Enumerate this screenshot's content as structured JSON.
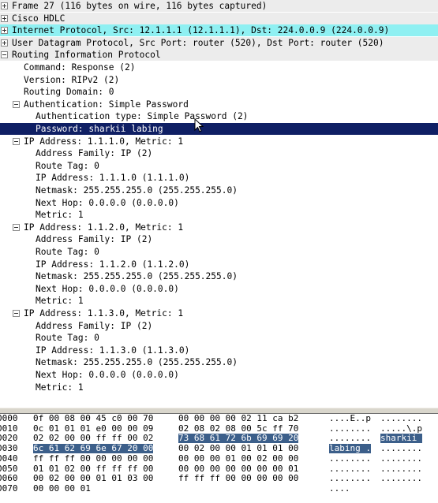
{
  "colors": {
    "header_row_bg": "#ececec",
    "ip_row_bg": "#8ff0f2",
    "selected_row_bg": "#0f1f64",
    "hex_highlight_bg": "#3c5f8a"
  },
  "tree": [
    {
      "label": "Frame 27 (116 bytes on wire, 116 bytes captured)",
      "expander": "plus"
    },
    {
      "label": "Cisco HDLC",
      "expander": "plus"
    },
    {
      "label": "Internet Protocol, Src: 12.1.1.1 (12.1.1.1), Dst: 224.0.0.9 (224.0.0.9)",
      "expander": "plus"
    },
    {
      "label": "User Datagram Protocol, Src Port: router (520), Dst Port: router (520)",
      "expander": "plus"
    },
    {
      "label": "Routing Information Protocol",
      "expander": "minus"
    },
    {
      "label": "Command: Response (2)"
    },
    {
      "label": "Version: RIPv2 (2)"
    },
    {
      "label": "Routing Domain: 0"
    },
    {
      "label": "Authentication: Simple Password",
      "expander": "minus"
    },
    {
      "label": "Authentication type: Simple Password (2)"
    },
    {
      "label": "Password: sharkii labing",
      "selected": true
    },
    {
      "label": "IP Address: 1.1.1.0, Metric: 1",
      "expander": "minus"
    },
    {
      "label": "Address Family: IP (2)"
    },
    {
      "label": "Route Tag: 0"
    },
    {
      "label": "IP Address: 1.1.1.0 (1.1.1.0)"
    },
    {
      "label": "Netmask: 255.255.255.0 (255.255.255.0)"
    },
    {
      "label": "Next Hop: 0.0.0.0 (0.0.0.0)"
    },
    {
      "label": "Metric: 1"
    },
    {
      "label": "IP Address: 1.1.2.0, Metric: 1",
      "expander": "minus"
    },
    {
      "label": "Address Family: IP (2)"
    },
    {
      "label": "Route Tag: 0"
    },
    {
      "label": "IP Address: 1.1.2.0 (1.1.2.0)"
    },
    {
      "label": "Netmask: 255.255.255.0 (255.255.255.0)"
    },
    {
      "label": "Next Hop: 0.0.0.0 (0.0.0.0)"
    },
    {
      "label": "Metric: 1"
    },
    {
      "label": "IP Address: 1.1.3.0, Metric: 1",
      "expander": "minus"
    },
    {
      "label": "Address Family: IP (2)"
    },
    {
      "label": "Route Tag: 0"
    },
    {
      "label": "IP Address: 1.1.3.0 (1.1.3.0)"
    },
    {
      "label": "Netmask: 255.255.255.0 (255.255.255.0)"
    },
    {
      "label": "Next Hop: 0.0.0.0 (0.0.0.0)"
    },
    {
      "label": "Metric: 1"
    }
  ],
  "hex": [
    {
      "offset": "0000",
      "bytes1": "0f 00 08 00 45 c0 00 70",
      "bytes2": "00 00 00 00 02 11 ca b2",
      "ascii1": "....E..p",
      "ascii2": "........"
    },
    {
      "offset": "0010",
      "bytes1": "0c 01 01 01 e0 00 00 09",
      "bytes2": "02 08 02 08 00 5c ff 70",
      "ascii1": "........",
      "ascii2": ".....\\.p"
    },
    {
      "offset": "0020",
      "bytes1": "02 02 00 00 ff ff 00 02",
      "bytes2": "73 68 61 72 6b 69 69 20",
      "ascii1": "........",
      "ascii2": "sharkii ",
      "hl2": true
    },
    {
      "offset": "0030",
      "bytes1": "6c 61 62 69 6e 67 20 00",
      "bytes2": "00 02 00 00 01 01 01 00",
      "ascii1": "labing .",
      "ascii2": "........",
      "hl1": true
    },
    {
      "offset": "0040",
      "bytes1": "ff ff ff 00 00 00 00 00",
      "bytes2": "00 00 00 01 00 02 00 00",
      "ascii1": "........",
      "ascii2": "........"
    },
    {
      "offset": "0050",
      "bytes1": "01 01 02 00 ff ff ff 00",
      "bytes2": "00 00 00 00 00 00 00 01",
      "ascii1": "........",
      "ascii2": "........"
    },
    {
      "offset": "0060",
      "bytes1": "00 02 00 00 01 01 03 00",
      "bytes2": "ff ff ff 00 00 00 00 00",
      "ascii1": "........",
      "ascii2": "........"
    },
    {
      "offset": "0070",
      "bytes1": "00 00 00 01",
      "bytes2": "",
      "ascii1": "....",
      "ascii2": ""
    }
  ]
}
